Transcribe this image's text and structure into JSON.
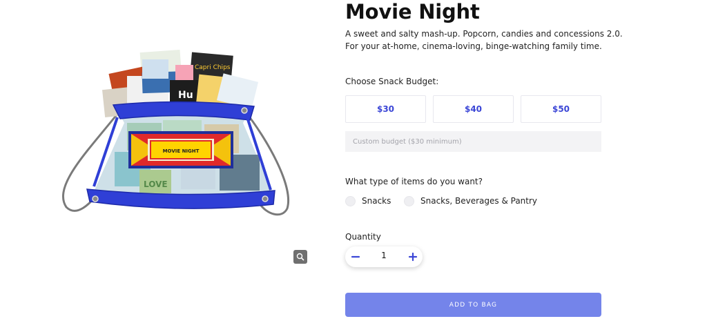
{
  "product": {
    "title": "Movie Night",
    "description_lines": [
      "A sweet and salty mash-up. Popcorn, candies and concessions 2.0.",
      "For your at-home, cinema-loving, binge-watching family time."
    ],
    "image": {
      "banner_text": "MOVIE NIGHT",
      "snack_labels": [
        "Capri Chips",
        "Hu",
        "LOVE"
      ]
    }
  },
  "budget": {
    "label": "Choose Snack Budget:",
    "options": [
      "$30",
      "$40",
      "$50"
    ],
    "custom_placeholder": "Custom budget ($30 minimum)",
    "custom_value": ""
  },
  "item_type": {
    "label": "What type of items do you want?",
    "options": [
      "Snacks",
      "Snacks, Beverages & Pantry"
    ]
  },
  "quantity": {
    "label": "Quantity",
    "value": "1"
  },
  "actions": {
    "add_to_bag": "ADD TO BAG"
  },
  "icons": {
    "zoom": "magnifier-icon",
    "minus": "minus-icon",
    "plus": "plus-icon"
  },
  "colors": {
    "accent_text": "#3b46d6",
    "button_bg": "#7484ea",
    "input_bg": "#f3f3f5",
    "bag_blue": "#2f3fd6"
  }
}
